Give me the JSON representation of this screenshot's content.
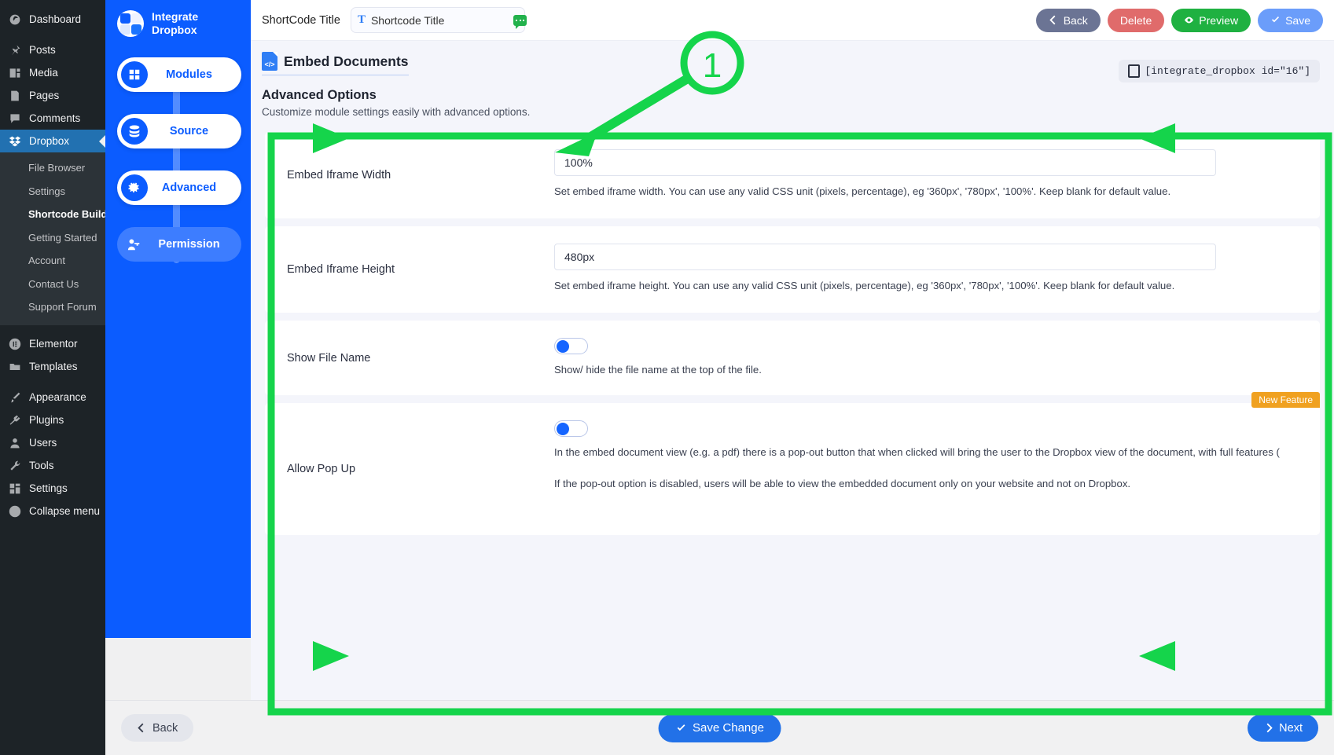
{
  "wp_admin": {
    "menu": [
      {
        "label": "Dashboard",
        "icon": "dashboard-icon"
      },
      {
        "label": "Posts",
        "icon": "pin-icon"
      },
      {
        "label": "Media",
        "icon": "media-icon"
      },
      {
        "label": "Pages",
        "icon": "pages-icon"
      },
      {
        "label": "Comments",
        "icon": "comments-icon"
      },
      {
        "label": "Dropbox",
        "icon": "dropbox-icon",
        "active": true
      }
    ],
    "submenu": [
      {
        "label": "File Browser"
      },
      {
        "label": "Settings"
      },
      {
        "label": "Shortcode Builder",
        "current": true
      },
      {
        "label": "Getting Started"
      },
      {
        "label": "Account"
      },
      {
        "label": "Contact Us"
      },
      {
        "label": "Support Forum"
      }
    ],
    "menu2": [
      {
        "label": "Elementor",
        "icon": "elementor-icon"
      },
      {
        "label": "Templates",
        "icon": "folder-icon"
      }
    ],
    "menu3": [
      {
        "label": "Appearance",
        "icon": "brush-icon"
      },
      {
        "label": "Plugins",
        "icon": "plug-icon"
      },
      {
        "label": "Users",
        "icon": "user-icon"
      },
      {
        "label": "Tools",
        "icon": "wrench-icon"
      },
      {
        "label": "Settings",
        "icon": "settings-icon"
      },
      {
        "label": "Collapse menu",
        "icon": "collapse-icon"
      }
    ]
  },
  "stepper": {
    "brand_line1": "Integrate",
    "brand_line2": "Dropbox",
    "steps": [
      {
        "label": "Modules",
        "icon": "grid-icon",
        "state": "done"
      },
      {
        "label": "Source",
        "icon": "database-icon",
        "state": "done"
      },
      {
        "label": "Advanced",
        "icon": "cogs-icon",
        "state": "active"
      },
      {
        "label": "Permission",
        "icon": "key-user-icon",
        "state": "upcoming"
      }
    ]
  },
  "topbar": {
    "shortcode_title_label": "ShortCode Title",
    "shortcode_title_value": "Shortcode Title",
    "shortcode_title_placeholder": "Shortcode Title",
    "back_label": "Back",
    "delete_label": "Delete",
    "preview_label": "Preview",
    "save_label": "Save"
  },
  "header": {
    "module_name": "Embed Documents",
    "section_title": "Advanced Options",
    "section_subtitle": "Customize module settings easily with advanced options.",
    "shortcode_tag": "[integrate_dropbox id=\"16\"]"
  },
  "settings": [
    {
      "label": "Embed Iframe Width",
      "type": "text",
      "value": "100%",
      "help": "Set embed iframe width. You can use any valid CSS unit (pixels, percentage), eg '360px', '780px', '100%'. Keep blank for default value."
    },
    {
      "label": "Embed Iframe Height",
      "type": "text",
      "value": "480px",
      "help": "Set embed iframe height. You can use any valid CSS unit (pixels, percentage), eg '360px', '780px', '100%'. Keep blank for default value."
    },
    {
      "label": "Show File Name",
      "type": "toggle",
      "value": "on",
      "help": "Show/ hide the file name at the top of the file."
    },
    {
      "label": "Allow Pop Up",
      "type": "toggle",
      "value": "on",
      "badge": "New Feature",
      "help": "In the embed document view (e.g. a pdf) there is a pop-out button that when clicked will bring the user to the Dropbox view of the document, with full features (",
      "help2": "If the pop-out option is disabled, users will be able to view the embedded document only on your website and not on Dropbox."
    }
  ],
  "footer": {
    "back_label": "Back",
    "save_change_label": "Save Change",
    "next_label": "Next"
  },
  "annotations": {
    "marker_1": "1",
    "accent_color": "#15d44b"
  }
}
